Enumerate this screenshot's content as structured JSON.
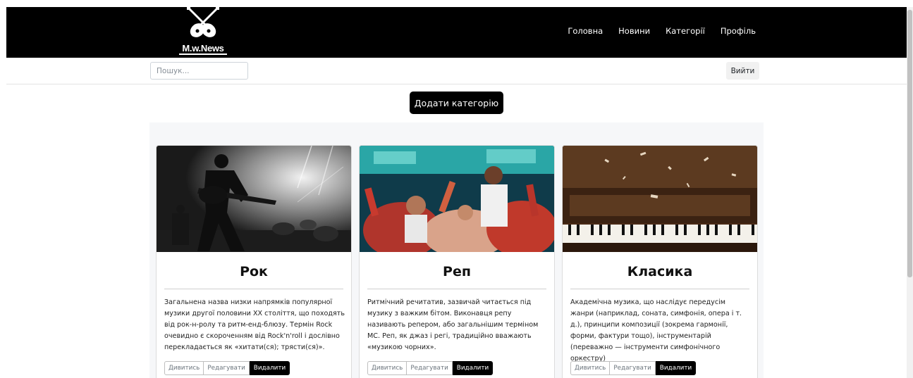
{
  "header": {
    "logo_text": "M.w.News",
    "logo_icon": "crossed-guitars-icon",
    "nav": [
      "Головна",
      "Новини",
      "Категорії",
      "Профіль"
    ]
  },
  "subbar": {
    "search_placeholder": "Пошук...",
    "logout_label": "Вийти"
  },
  "add_category_label": "Додати категорію",
  "cards": [
    {
      "title": "Рок",
      "description": "Загальнена назва низки напрямків популярної музики другої половини XX століття, що походять від рок-н-ролу та ритм-енд-блюзу. Термін Rock очевидно є скороченням від Rock'n'roll і дослівно перекладається як «хитати(ся); трясти(ся)».",
      "buttons": {
        "view": "Дивитись",
        "edit": "Редагувати",
        "delete": "Видалити"
      }
    },
    {
      "title": "Реп",
      "description": "Ритмічний речитатив, зазвичай читається під музику з важким бітом. Виконавця репу називають репером, або загальнішим терміном MC. Реп, як джаз і регі, традиційно вважають «музикою чорних».",
      "buttons": {
        "view": "Дивитись",
        "edit": "Редагувати",
        "delete": "Видалити"
      }
    },
    {
      "title": "Класика",
      "description": "Академічна музика, що наслідує передусім жанри (наприклад, соната, симфонія, опера і т. д.), принципи композиції (зокрема гармонії, форми, фактури тощо), інструментарій (переважно — інструменти симфонічного оркестру)",
      "buttons": {
        "view": "Дивитись",
        "edit": "Редагувати",
        "delete": "Видалити"
      }
    }
  ],
  "colors": {
    "header_bg": "#000000",
    "button_dark": "#000000",
    "cards_bg": "#f6f7f9"
  }
}
